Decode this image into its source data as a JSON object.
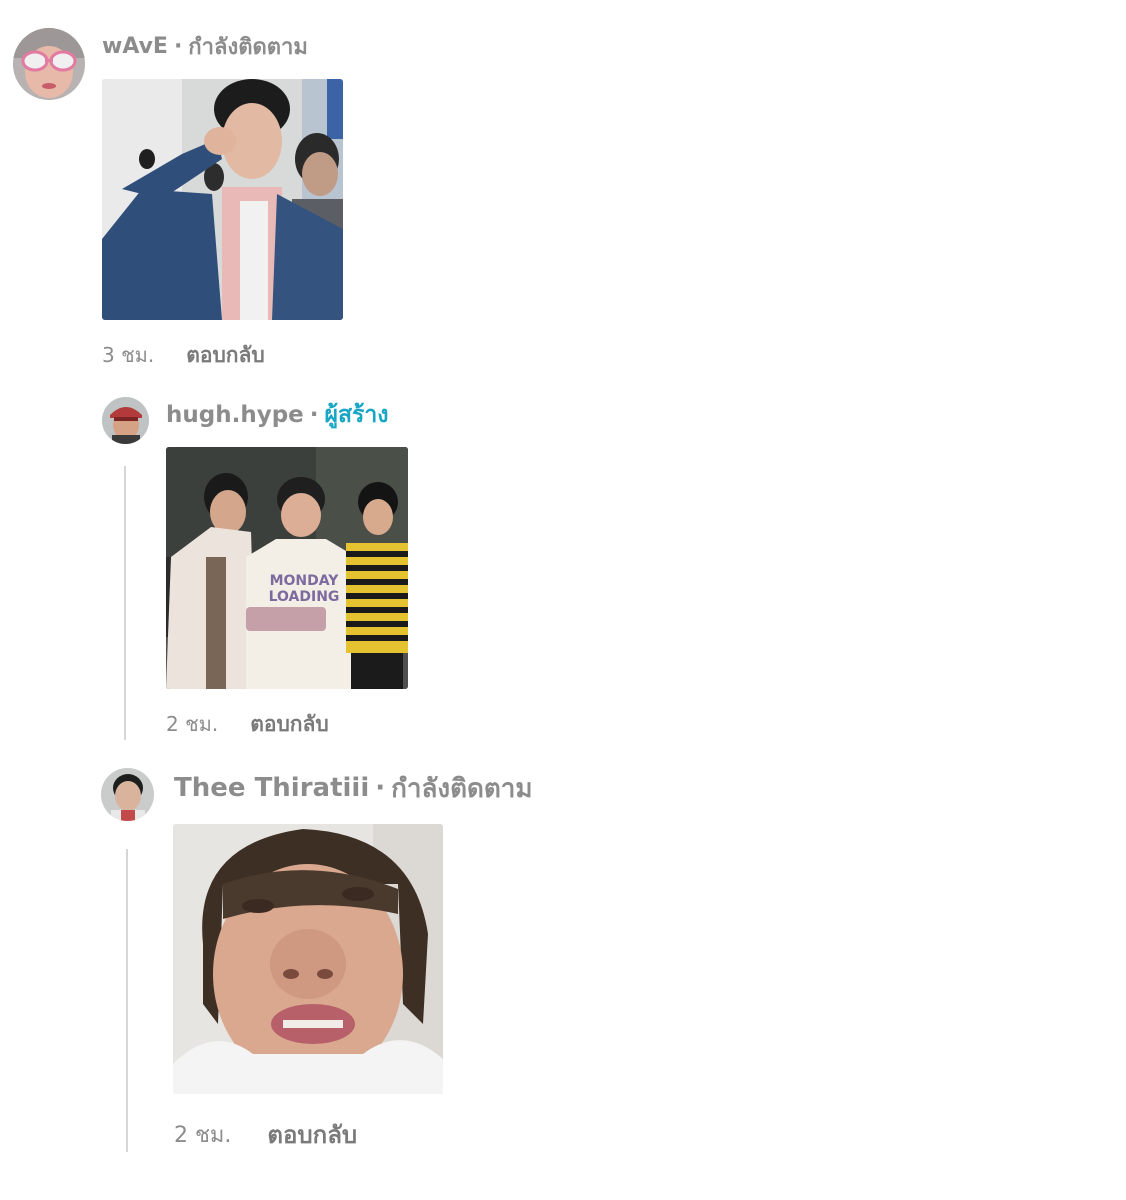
{
  "comments": [
    {
      "username": "wAvE",
      "separator": "·",
      "status": "กำลังติดตาม",
      "avatar_icon": "user-avatar-sunglasses",
      "photo_icon": "photo-man-denim-jacket",
      "time": "3 ชม.",
      "reply_label": "ตอบกลับ"
    },
    {
      "username": "hugh.hype",
      "separator": "·",
      "status": "ผู้สร้าง",
      "status_color": "#17a7c4",
      "avatar_icon": "user-avatar-cap",
      "photo_icon": "photo-three-friends",
      "photo_shirt_text": "MONDAY\nLOADING",
      "time": "2 ชม.",
      "reply_label": "ตอบกลับ"
    },
    {
      "username": "Thee Thiratiii",
      "separator": "·",
      "status": "กำลังติดตาม",
      "avatar_icon": "user-avatar-boy",
      "photo_icon": "photo-face-closeup",
      "time": "2 ชม.",
      "reply_label": "ตอบกลับ"
    }
  ]
}
